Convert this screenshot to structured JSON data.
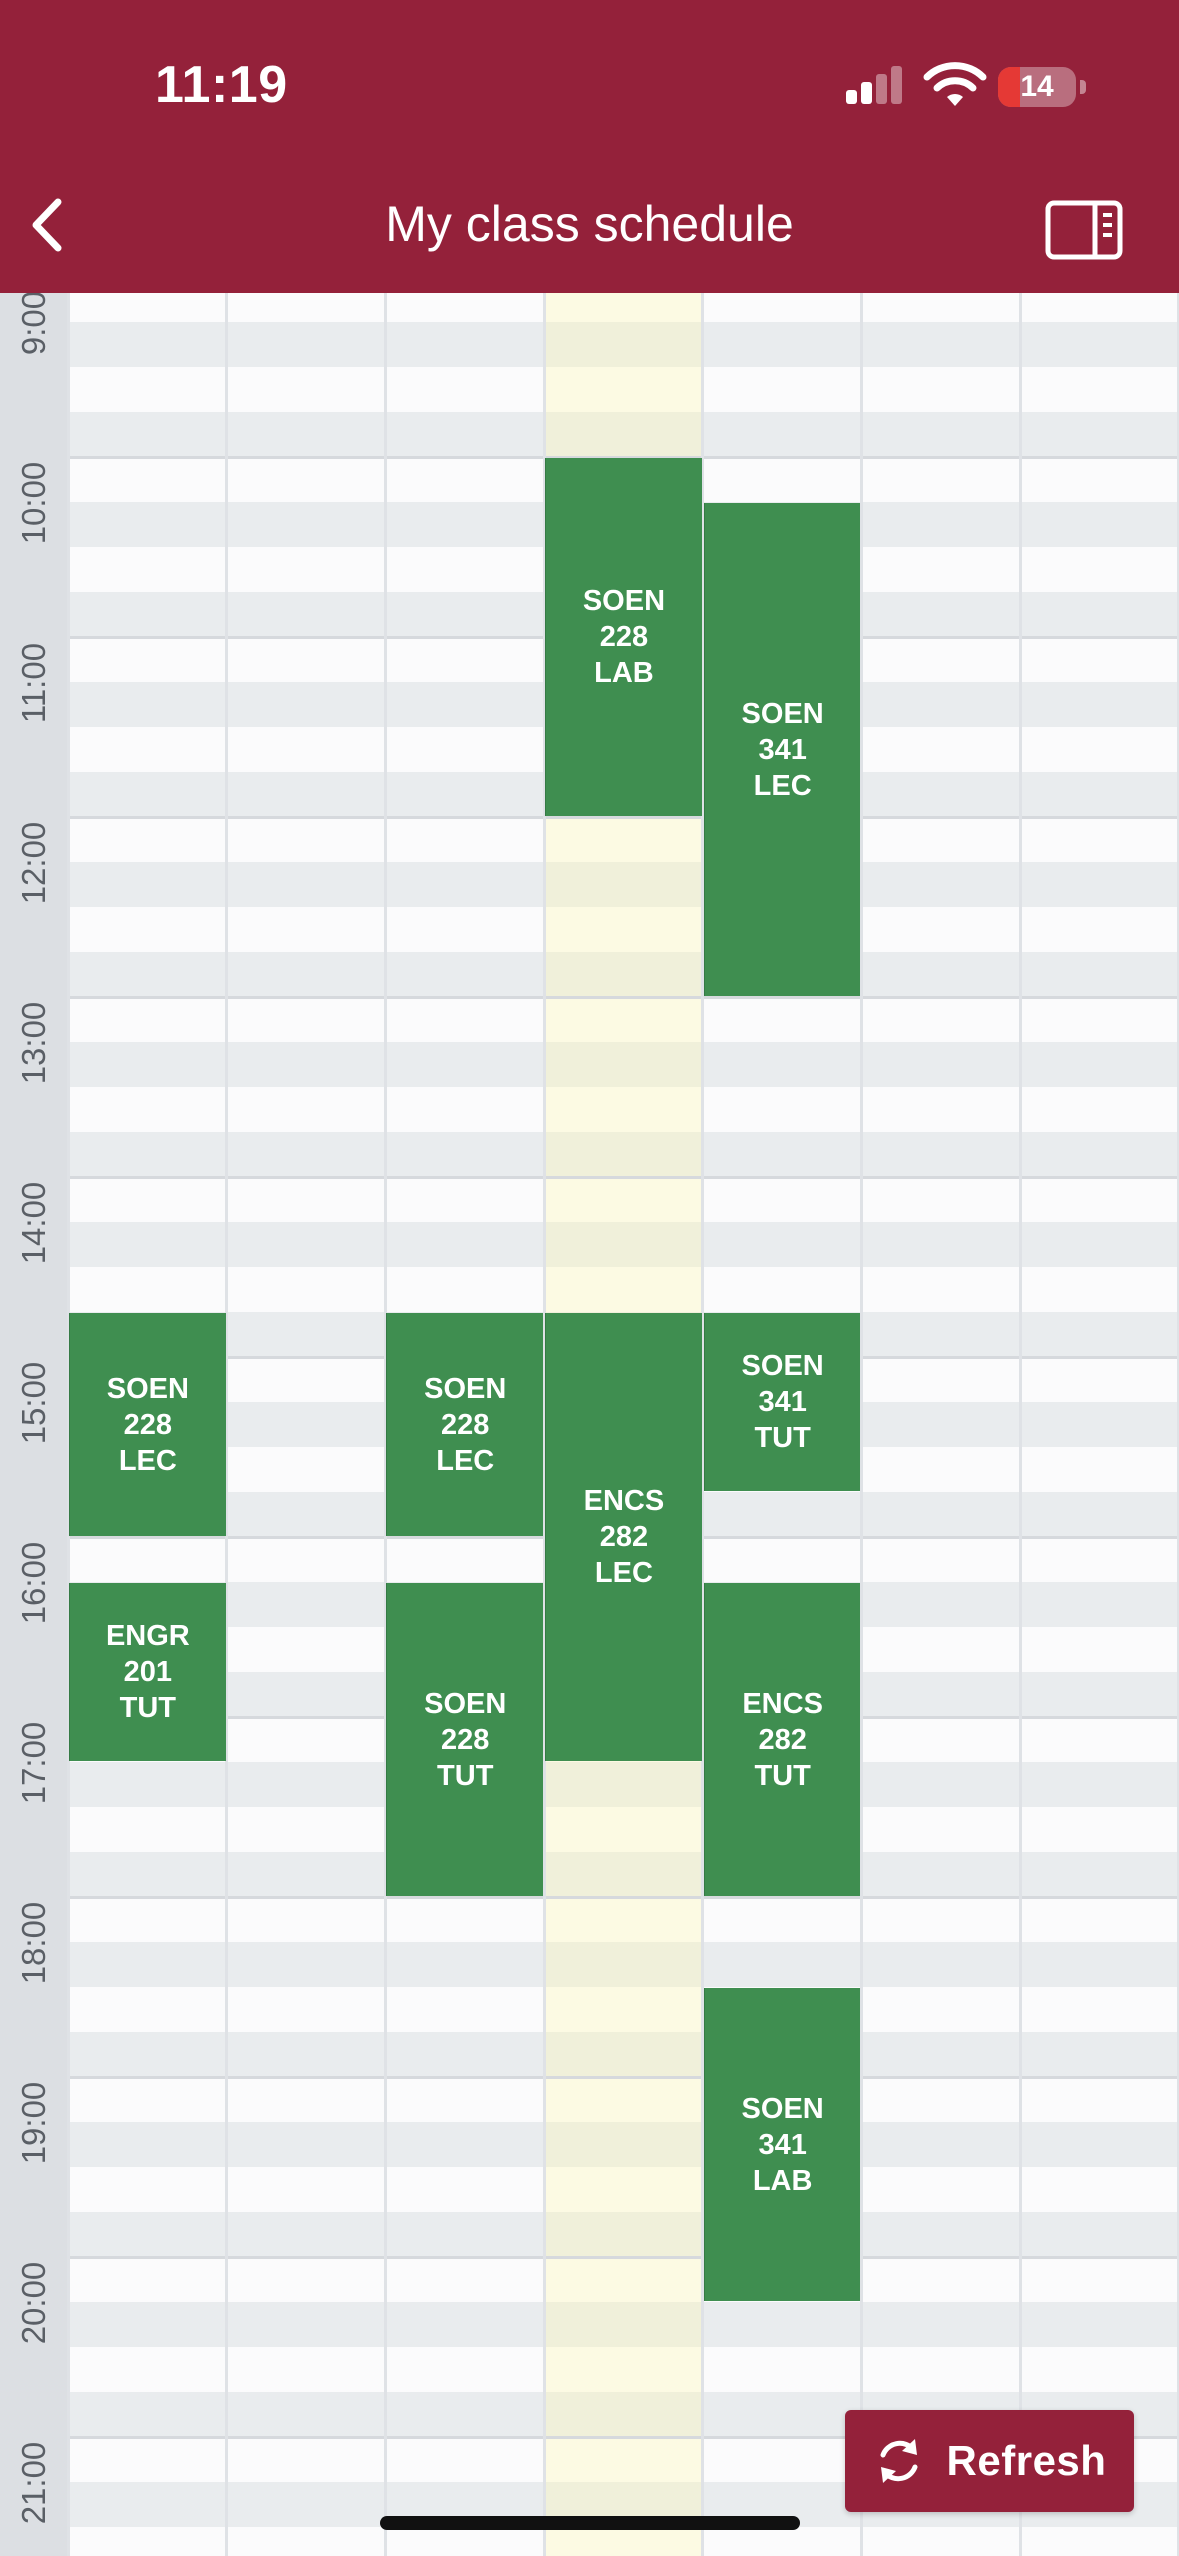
{
  "status_bar": {
    "time": "11:19",
    "battery": "14"
  },
  "header": {
    "title": "My class schedule"
  },
  "hours": [
    "9:00",
    "10:00",
    "11:00",
    "12:00",
    "13:00",
    "14:00",
    "15:00",
    "16:00",
    "17:00",
    "18:00",
    "19:00",
    "20:00",
    "21:00"
  ],
  "events": [
    {
      "label": "SOEN\n228\nLAB",
      "day": 3,
      "start": "10:00",
      "end": "12:00"
    },
    {
      "label": "SOEN\n341\nLEC",
      "day": 4,
      "start": "10:15",
      "end": "13:00"
    },
    {
      "label": "SOEN\n228\nLEC",
      "day": 0,
      "start": "14:45",
      "end": "16:00"
    },
    {
      "label": "SOEN\n228\nLEC",
      "day": 2,
      "start": "14:45",
      "end": "16:00"
    },
    {
      "label": "ENCS\n282\nLEC",
      "day": 3,
      "start": "14:45",
      "end": "17:15"
    },
    {
      "label": "SOEN\n341\nTUT",
      "day": 4,
      "start": "14:45",
      "end": "15:45"
    },
    {
      "label": "ENGR\n201\nTUT",
      "day": 0,
      "start": "16:15",
      "end": "17:15"
    },
    {
      "label": "SOEN\n228\nTUT",
      "day": 2,
      "start": "16:15",
      "end": "18:00"
    },
    {
      "label": "ENCS\n282\nTUT",
      "day": 4,
      "start": "16:15",
      "end": "18:00"
    },
    {
      "label": "SOEN\n341\nLAB",
      "day": 4,
      "start": "18:30",
      "end": "20:15"
    }
  ],
  "refresh": {
    "label": "Refresh"
  },
  "colors": {
    "header": "#94213a",
    "event": "#3f8e50",
    "today_highlight": "#fbfbe0"
  }
}
